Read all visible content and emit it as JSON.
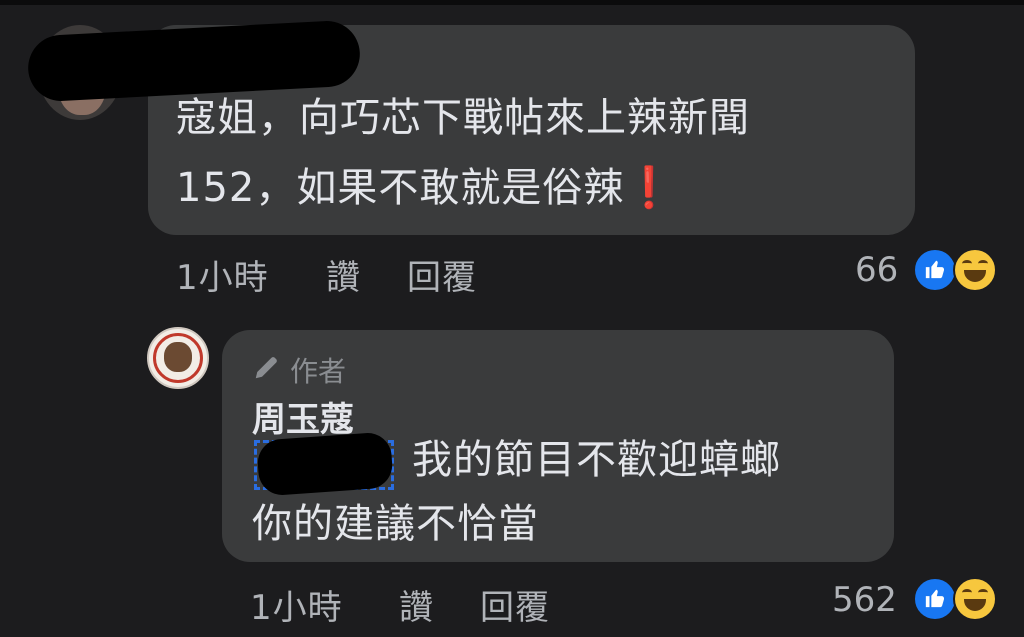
{
  "comment1": {
    "text_line1": "寇姐，向巧芯下戰帖來上辣新聞",
    "text_line2": "152，如果不敢就是俗辣",
    "emphasis_icon": "❗",
    "time": "1小時",
    "like_action": "讚",
    "reply_action": "回覆",
    "reaction_count": "66",
    "reactions": [
      "like-icon",
      "haha-icon"
    ]
  },
  "reply1": {
    "badge_icon": "pencil-icon",
    "badge_label": "作者",
    "author": "周玉蔻",
    "text_line1": "我的節目不歡迎蟑螂",
    "text_line2": "你的建議不恰當",
    "time": "1小時",
    "like_action": "讚",
    "reply_action": "回覆",
    "reaction_count": "562",
    "reactions": [
      "like-icon",
      "haha-icon"
    ]
  },
  "colors": {
    "background": "#1c1c1e",
    "bubble": "#3a3b3c",
    "text": "#e4e6eb",
    "muted": "#b0b3b8",
    "like_blue": "#1877f2",
    "haha_yellow": "#f7c73e",
    "warning_red": "#e0282e"
  }
}
